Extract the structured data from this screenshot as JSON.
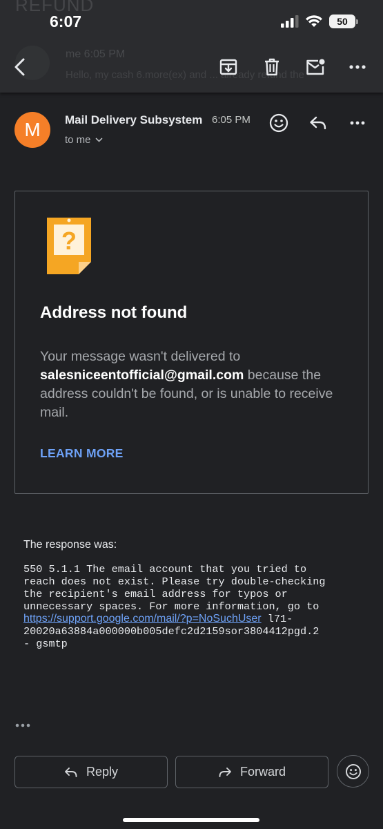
{
  "status_bar": {
    "time": "6:07",
    "battery": "50"
  },
  "background_thread": {
    "subject": "REFUND",
    "sender": "me 6:05 PM",
    "snippet": "Hello, my cash 6.more(ex) and ... already refund the"
  },
  "toolbar": {
    "back_icon": "chevron-left-icon",
    "archive_icon": "archive-icon",
    "delete_icon": "trash-icon",
    "mark_unread_icon": "mail-unread-icon",
    "more_icon": "more-horizontal-icon"
  },
  "message": {
    "avatar_letter": "M",
    "avatar_color": "#f57f28",
    "sender": "Mail Delivery Subsystem",
    "time": "6:05 PM",
    "recipient": "to me"
  },
  "card": {
    "title": "Address not found",
    "body_prefix": "Your message wasn't delivered to ",
    "email": "salesniceentofficial@gmail.com",
    "body_suffix": " because the address couldn't be found, or is unable to receive mail.",
    "learn_more": "LEARN MORE"
  },
  "response": {
    "label": "The response was:",
    "code_text": "550 5.1.1 The email account that you tried to\nreach does not exist. Please try double-checking\nthe recipient's email address for typos or\nunnecessary spaces. For more information, go to\n",
    "link": "https://support.google.com/mail/?p=NoSuchUser",
    "code_tail": " l71-\n20020a63884a000000b005defc2d2159sor3804412pgd.2\n- gsmtp"
  },
  "actions": {
    "reply": "Reply",
    "forward": "Forward"
  },
  "colors": {
    "accent": "#6ea2f7",
    "background": "#202124",
    "icon_orange": "#f5a623"
  }
}
